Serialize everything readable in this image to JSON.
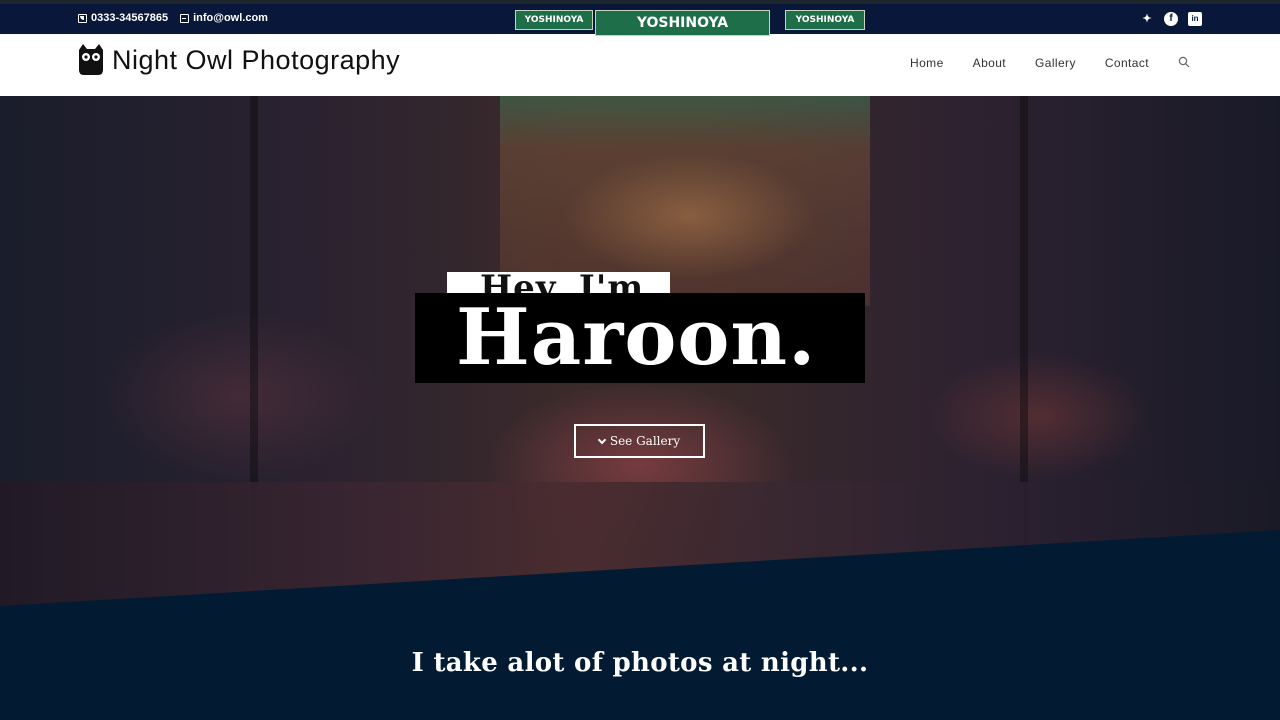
{
  "topbar": {
    "phone": "0333-34567865",
    "email": "info@owl.com",
    "social": [
      {
        "icon": "twitter-icon",
        "glyph": "🐦︎"
      },
      {
        "icon": "facebook-icon",
        "glyph": "f"
      },
      {
        "icon": "linkedin-icon",
        "glyph": "in"
      }
    ]
  },
  "header": {
    "brand": "Night Owl Photography",
    "nav": [
      "Home",
      "About",
      "Gallery",
      "Contact"
    ]
  },
  "hero": {
    "greeting": "Hey, I'm",
    "name": "Haroon.",
    "cta_label": "See Gallery",
    "store_signs": [
      "YOSHINOYA",
      "YOSHINOYA",
      "YOSHINOYA"
    ]
  },
  "section": {
    "tagline": "I take alot of photos at night..."
  },
  "colors": {
    "topbar": "#08173a",
    "section_bg": "#021b33",
    "header_bg": "#ffffff"
  }
}
